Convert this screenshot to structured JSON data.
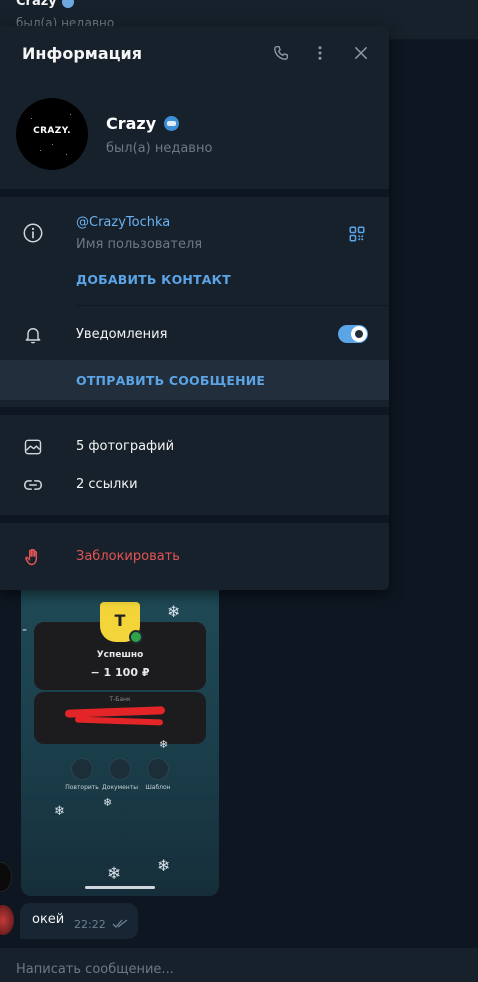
{
  "chat": {
    "name": "Crazy",
    "status": "был(а) недавно",
    "composer_placeholder": "Написать сообщение..."
  },
  "info": {
    "title": "Информация",
    "profile": {
      "avatar_text": "CRAZY.",
      "name": "Crazy",
      "status": "был(а) недавно"
    },
    "username": "@CrazyTochka",
    "username_caption": "Имя пользователя",
    "add_contact": "ДОБАВИТЬ КОНТАКТ",
    "notifications_label": "Уведомления",
    "notifications_on": true,
    "send_message": "ОТПРАВИТЬ СООБЩЕНИЕ",
    "photos": "5 фотографий",
    "links": "2 ссылки",
    "block": "Заблокировать"
  },
  "receipt": {
    "bank_letter": "T",
    "status": "Успешно",
    "amount": "− 1 100 ₽",
    "bank_name": "Т-Банк",
    "actions": [
      "Повторить",
      "Документы",
      "Шаблон"
    ]
  },
  "message": {
    "text": "окей",
    "time": "22:22"
  },
  "colors": {
    "panel_bg": "#17212b",
    "app_bg": "#0e1621",
    "accent": "#5ba4e6",
    "danger": "#e45454",
    "link": "#6ab2f2"
  },
  "icons": [
    "phone-icon",
    "more-vertical-icon",
    "close-icon",
    "info-icon",
    "qr-code-icon",
    "bell-icon",
    "photo-icon",
    "link-icon",
    "hand-stop-icon"
  ]
}
